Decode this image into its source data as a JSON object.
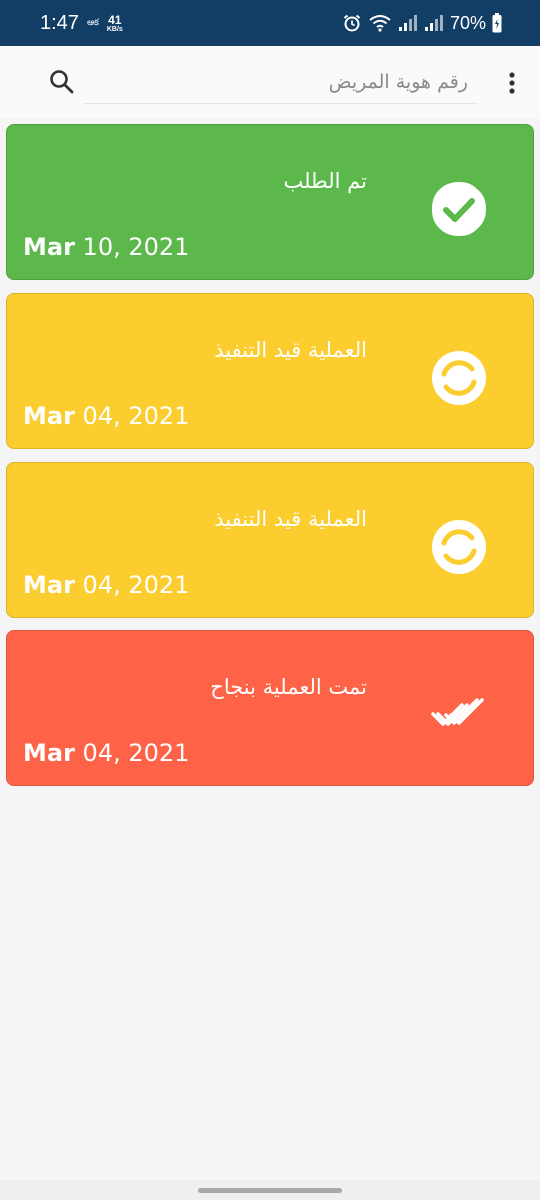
{
  "status_bar": {
    "time": "1:47",
    "carrier_label": "ఆక",
    "net_speed_value": "41",
    "net_speed_unit": "KB/s",
    "battery_percent": "70%"
  },
  "search": {
    "placeholder": "رقم هوية المريض"
  },
  "cards": [
    {
      "title": "تم الطلب",
      "date_month": "Mar",
      "date_rest": " 10, 2021",
      "color": "#5cb84b",
      "icon": "check-circle-icon"
    },
    {
      "title": "العملية قيد التنفيذ",
      "date_month": "Mar",
      "date_rest": " 04, 2021",
      "color": "#fbcd2e",
      "icon": "progress-ring-icon"
    },
    {
      "title": "العملية قيد التنفيذ",
      "date_month": "Mar",
      "date_rest": " 04, 2021",
      "color": "#fbcd2e",
      "icon": "progress-ring-icon"
    },
    {
      "title": "تمت العملية بنجاح",
      "date_month": "Mar",
      "date_rest": " 04, 2021",
      "color": "#fe6347",
      "icon": "double-check-icon"
    }
  ]
}
